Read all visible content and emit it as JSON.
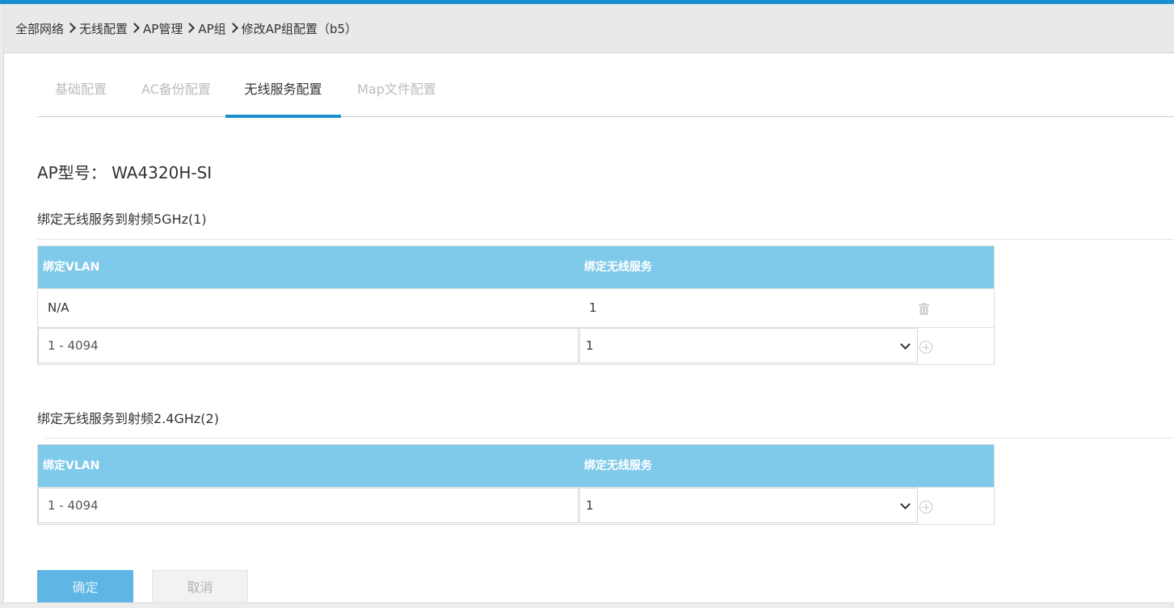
{
  "breadcrumb": [
    "全部网络",
    "无线配置",
    "AP管理",
    "AP组",
    "修改AP组配置（b5）"
  ],
  "tabs": [
    {
      "label": "基础配置",
      "active": false
    },
    {
      "label": "AC备份配置",
      "active": false
    },
    {
      "label": "无线服务配置",
      "active": true
    },
    {
      "label": "Map文件配置",
      "active": false
    }
  ],
  "model": "AP型号：  WA4320H-SI",
  "radio1": {
    "title": "绑定无线服务到射频5GHz(1)",
    "col_vlan": "绑定VLAN",
    "col_service": "绑定无线服务",
    "row": {
      "vlan": "N/A",
      "service": "1"
    },
    "vlan_placeholder": "1 - 4094",
    "service_selected": "1"
  },
  "radio2": {
    "title": "绑定无线服务到射频2.4GHz(2)",
    "col_vlan": "绑定VLAN",
    "col_service": "绑定无线服务",
    "vlan_placeholder": "1 - 4094",
    "service_selected": "1"
  },
  "buttons": {
    "ok": "确定",
    "cancel": "取消"
  },
  "colors": {
    "accent": "#1a8fd0",
    "table_header": "#7fc9ea",
    "ok_button": "#5fb6e4"
  }
}
